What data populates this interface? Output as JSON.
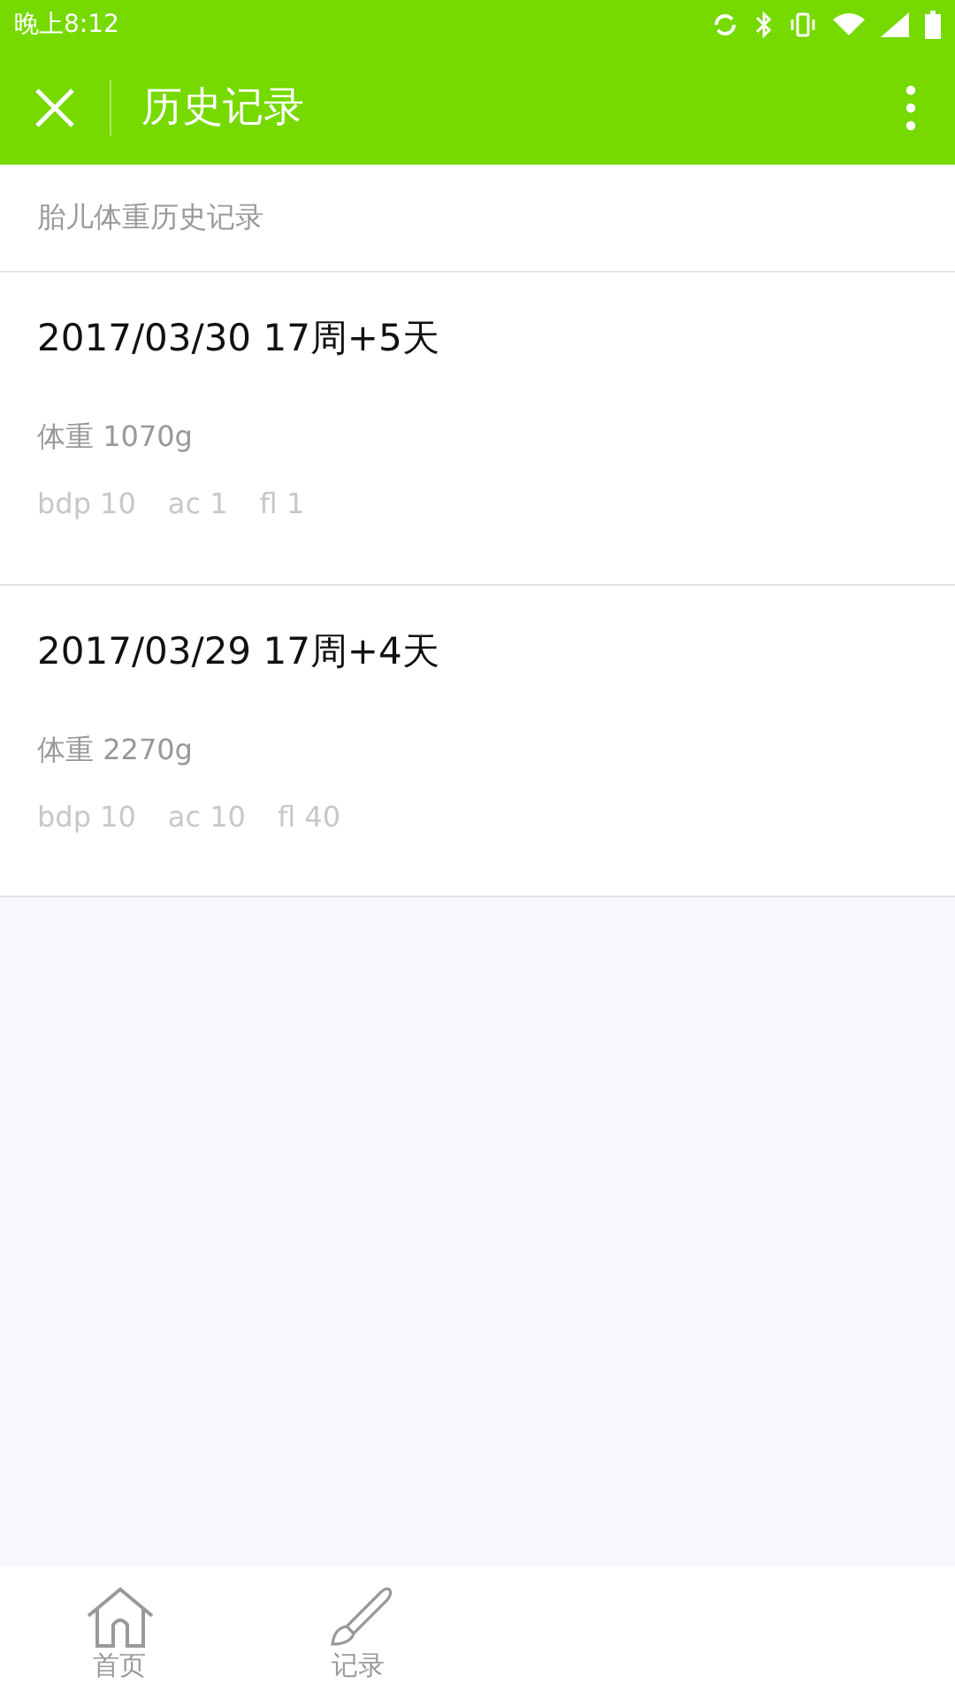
{
  "status_bar": {
    "time": "晚上8:12"
  },
  "header": {
    "title": "历史记录"
  },
  "section_title": "胎儿体重历史记录",
  "records": [
    {
      "date": "2017/03/30 17周+5天",
      "weight": "体重 1070g",
      "measures": [
        "bdp 10",
        "ac 1",
        "fl 1"
      ]
    },
    {
      "date": "2017/03/29 17周+4天",
      "weight": "体重 2270g",
      "measures": [
        "bdp 10",
        "ac 10",
        "fl 40"
      ]
    }
  ],
  "tab_bar": [
    {
      "kind": "home",
      "label": "首页"
    },
    {
      "kind": "brush",
      "label": "记录"
    }
  ]
}
